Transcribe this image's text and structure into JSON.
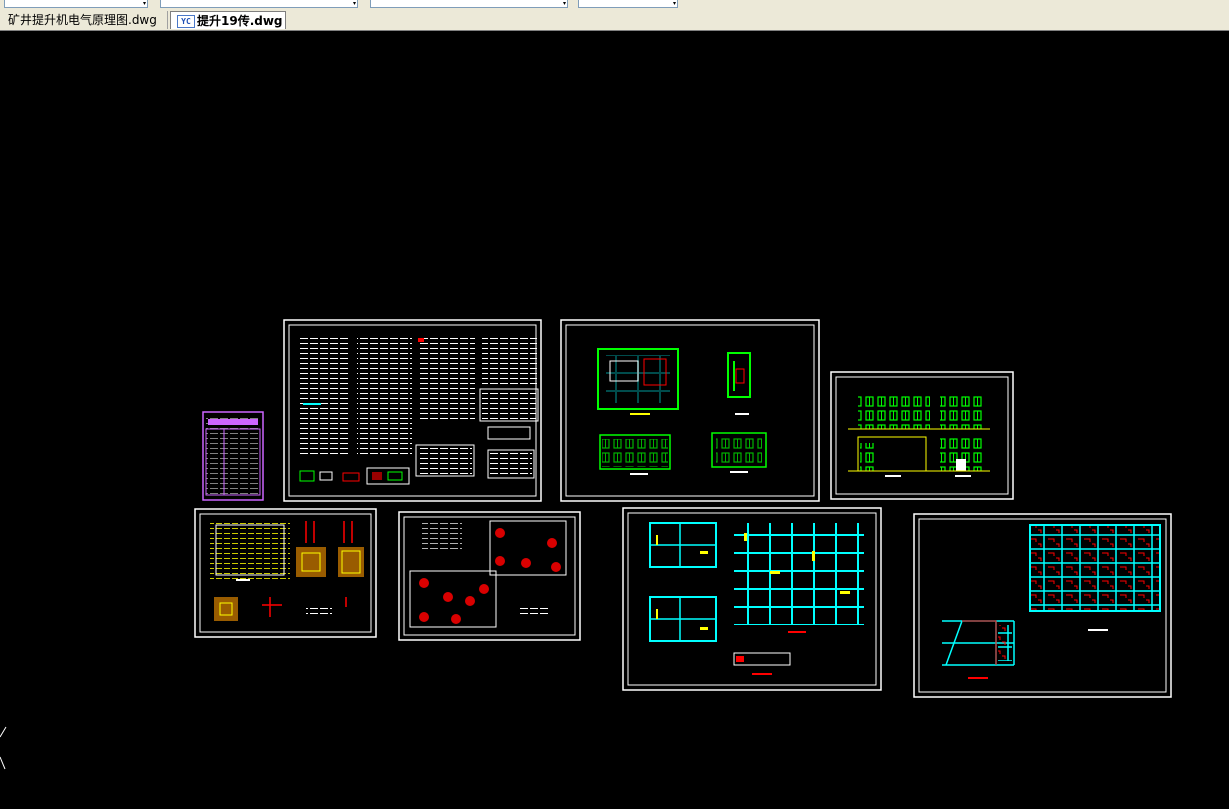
{
  "toolbar": {
    "combos": [
      {
        "name": "layer-combo"
      },
      {
        "name": "color-combo"
      },
      {
        "name": "linetype-combo"
      },
      {
        "name": "lineweight-combo"
      }
    ]
  },
  "tabs": [
    {
      "label": "矿井提升机电气原理图.dwg",
      "active": false
    },
    {
      "label": "提升19传.dwg",
      "active": true,
      "icon": "cad-file-icon",
      "icon_text": "YC"
    }
  ],
  "canvas": {
    "background": "#000000",
    "sheet_border_color": "#ffffff",
    "accent_colors": {
      "green": "#00ff00",
      "yellow": "#ffff00",
      "cyan": "#00ffff",
      "red": "#ff0000",
      "magenta": "#cc66ff"
    },
    "sheets": [
      {
        "name": "cover-sheet"
      },
      {
        "name": "design-notes-sheet"
      },
      {
        "name": "floor-plans-sheet"
      },
      {
        "name": "elevations-sheet"
      },
      {
        "name": "foundation-details-sheet"
      },
      {
        "name": "pile-layout-sheet"
      },
      {
        "name": "beam-framing-sheet"
      },
      {
        "name": "slab-reinforcement-sheet"
      }
    ]
  }
}
